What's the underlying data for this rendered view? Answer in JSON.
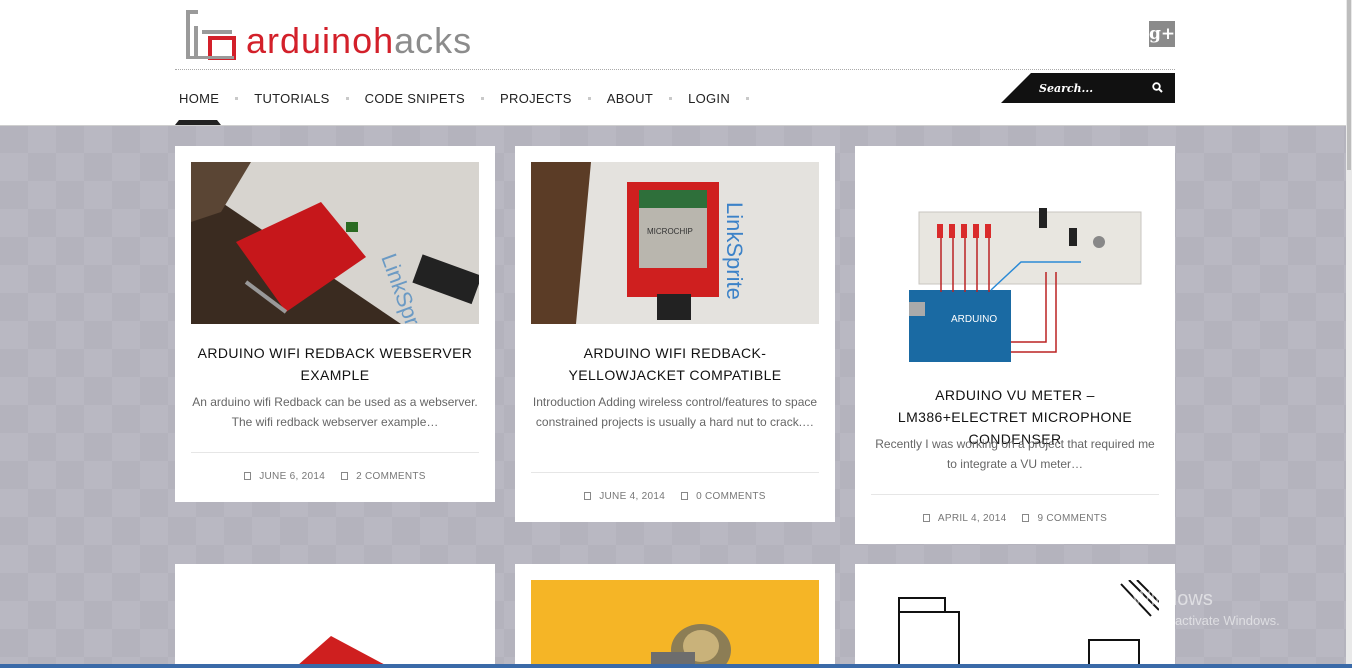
{
  "brand": {
    "logo_red": "arduino",
    "logo_grey_h": "h",
    "logo_grey_rest": "acks",
    "mark": "ha"
  },
  "header": {
    "gplus_label": "g+"
  },
  "nav": {
    "items": [
      "HOME",
      "TUTORIALS",
      "CODE SNIPETS",
      "PROJECTS",
      "ABOUT",
      "LOGIN"
    ]
  },
  "search": {
    "placeholder": "Search..."
  },
  "posts": [
    {
      "title": "ARDUINO WIFI REDBACK WEBSERVER EXAMPLE",
      "excerpt": "An arduino wifi Redback can be used as a webserver. The wifi redback webserver example…",
      "date": "JUNE 6, 2014",
      "comments": "2 COMMENTS"
    },
    {
      "title": "ARDUINO WIFI REDBACK-YELLOWJACKET COMPATIBLE",
      "excerpt": "Introduction Adding wireless control/features to space constrained projects is usually a hard nut to crack.…",
      "date": "JUNE 4, 2014",
      "comments": "0 COMMENTS"
    },
    {
      "title": "ARDUINO VU METER – LM386+ELECTRET MICROPHONE CONDENSER",
      "excerpt": "Recently I was working on a project that required me to integrate a VU meter…",
      "date": "APRIL 4, 2014",
      "comments": "9 COMMENTS"
    }
  ],
  "watermark": {
    "line1": "Activate Windows",
    "line2": "Go to PC settings to activate Windows."
  },
  "colors": {
    "brand_red": "#d3202a",
    "nav_dark": "#111111",
    "background": "#b4b3bd"
  }
}
